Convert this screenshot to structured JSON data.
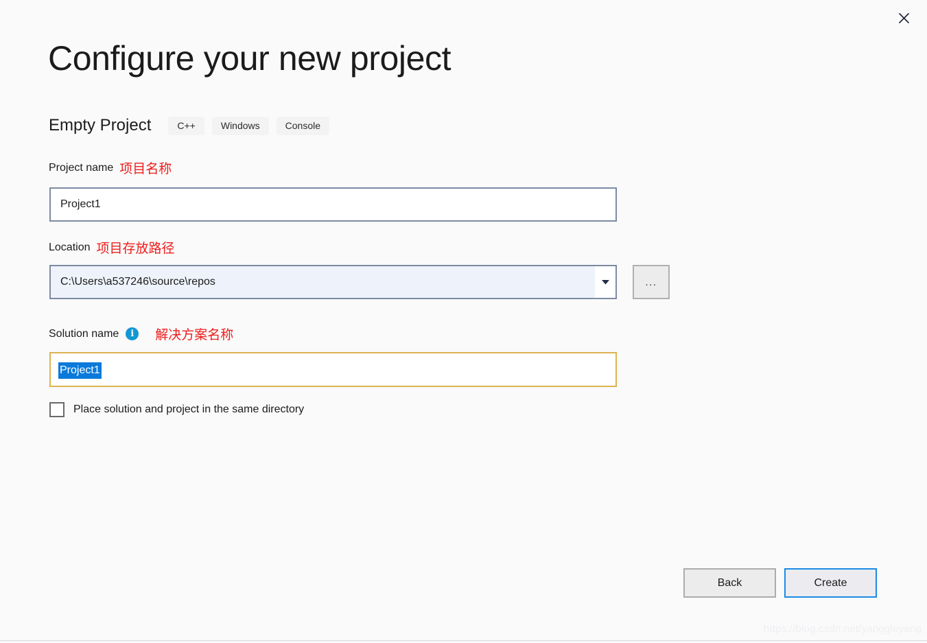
{
  "window": {
    "close_icon": "close-icon"
  },
  "header": {
    "title": "Configure your new project",
    "template_name": "Empty Project",
    "tags": [
      "C++",
      "Windows",
      "Console"
    ]
  },
  "fields": {
    "project_name": {
      "label": "Project name",
      "annotation_zh": "项目名称",
      "value": "Project1",
      "placeholder": ""
    },
    "location": {
      "label": "Location",
      "annotation_zh": "项目存放路径",
      "value": "C:\\Users\\a537246\\source\\repos",
      "dropdown_icon": "chevron-down-icon",
      "browse_label": "..."
    },
    "solution_name": {
      "label": "Solution name",
      "info_icon": "info-icon",
      "info_glyph": "i",
      "annotation_zh": "解决方案名称",
      "value": "Project1",
      "selected": true
    },
    "same_directory": {
      "label": "Place solution and project in the same directory",
      "checked": false
    }
  },
  "footer": {
    "back_label": "Back",
    "create_label": "Create"
  },
  "watermark": {
    "text": "https://blog.csdn.net/yanggleyang"
  },
  "colors": {
    "page_background": "#fafafa",
    "input_border": "#7c8aa3",
    "focus_border_gold": "#dcb350",
    "selection_blue": "#0a7ada",
    "accent_blue": "#1a8ae5",
    "annotation_red": "#ee1c1c",
    "info_icon_blue": "#1296d4",
    "combo_background": "#eef2fb",
    "button_face": "#ececec"
  }
}
